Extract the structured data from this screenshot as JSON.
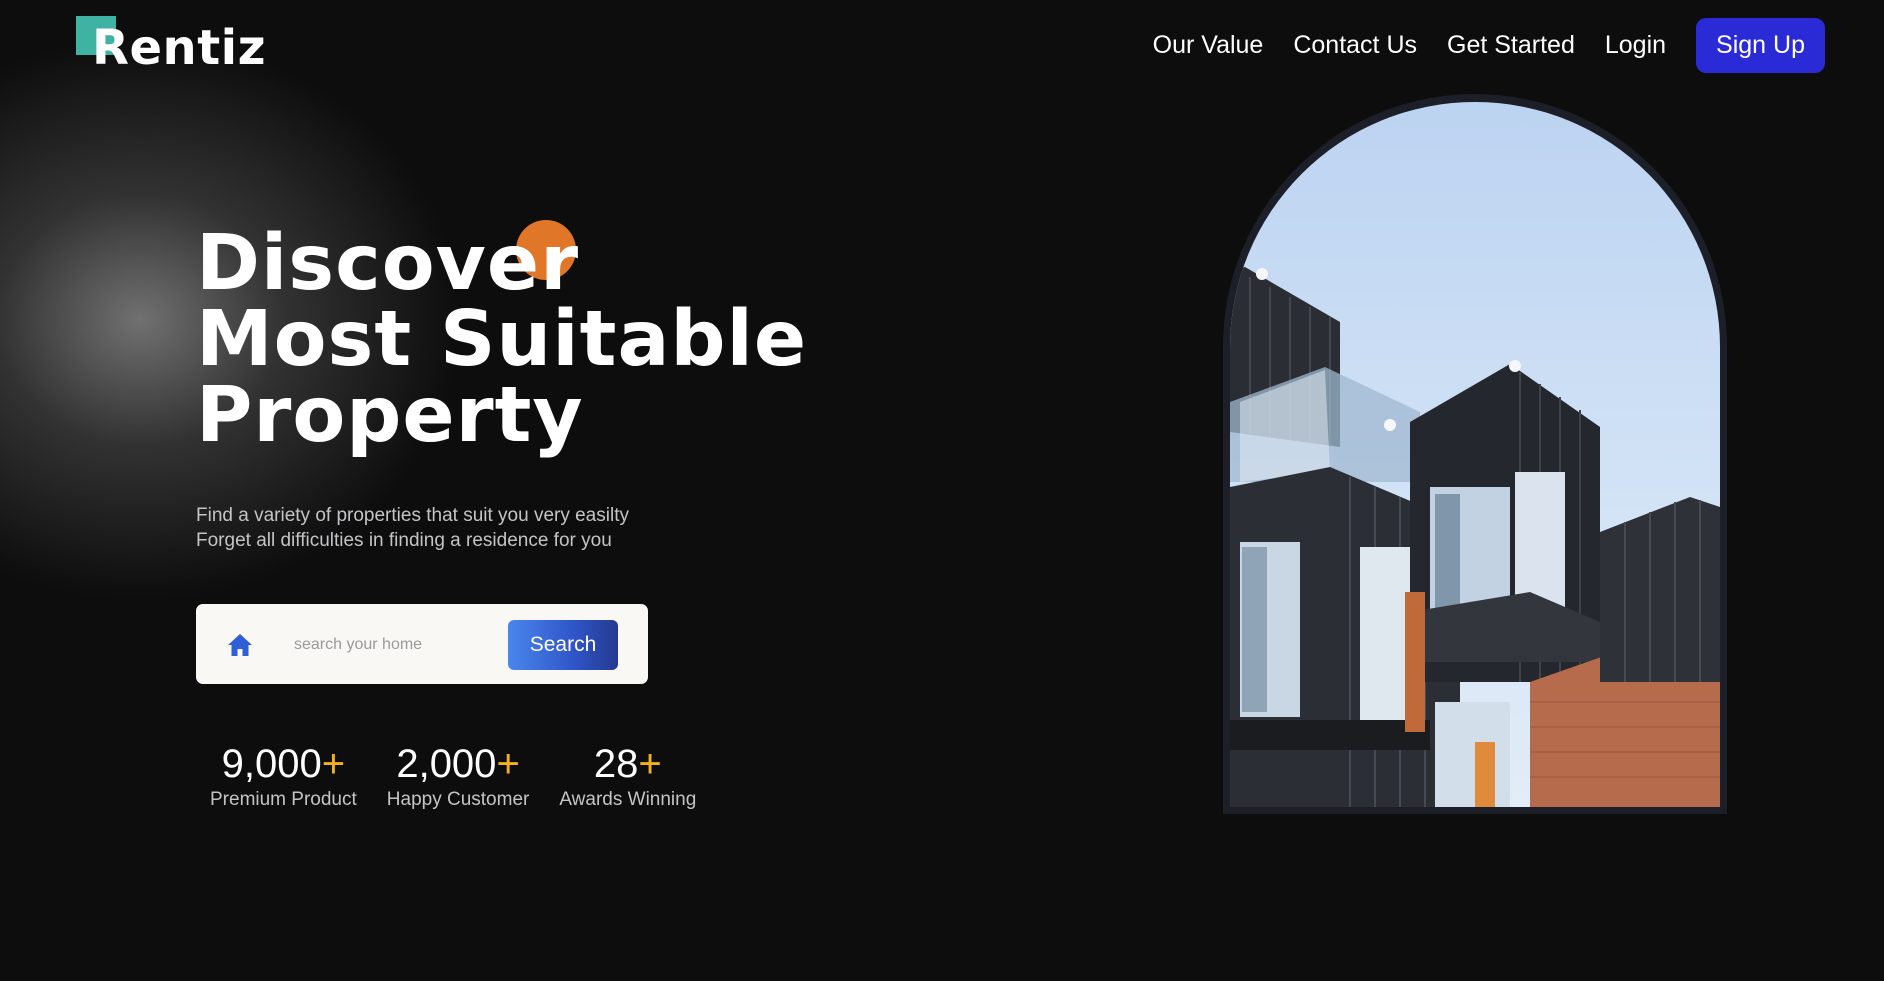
{
  "brand": {
    "name": "Rentiz",
    "accent_color": "#3fb2a3"
  },
  "nav": {
    "links": [
      "Our Value",
      "Contact Us",
      "Get Started",
      "Login"
    ],
    "signup_label": "Sign Up",
    "signup_color": "#2a2bd6"
  },
  "hero": {
    "headline": [
      "Discover",
      "Most Suitable",
      "Property"
    ],
    "dot_color": "#e07628",
    "subtext": [
      "Find a variety of properties that suit you very easilty",
      "Forget all difficulties in finding a residence for you"
    ]
  },
  "search": {
    "icon": "home-icon",
    "placeholder": "search your home",
    "value": "",
    "button_label": "Search"
  },
  "stats": [
    {
      "value": "9,000",
      "suffix": "+",
      "label": "Premium Product"
    },
    {
      "value": "2,000",
      "suffix": "+",
      "label": "Happy Customer"
    },
    {
      "value": "28",
      "suffix": "+",
      "label": "Awards Winning"
    }
  ],
  "stat_suffix_color": "#f3b21c"
}
